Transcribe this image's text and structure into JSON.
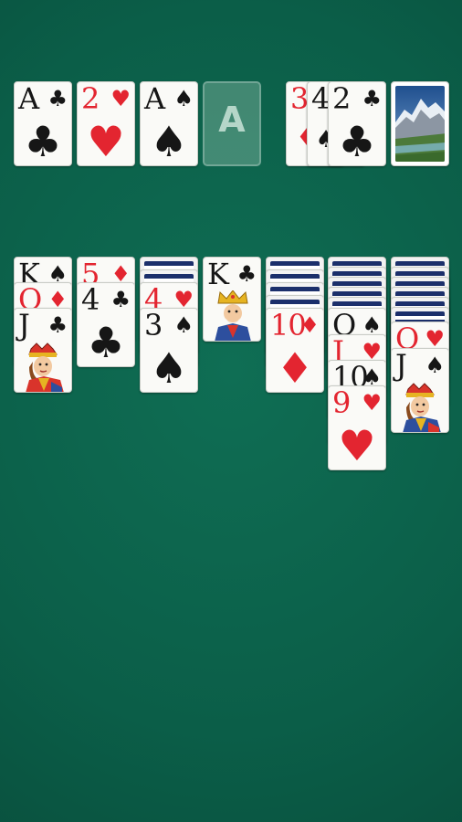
{
  "game": "Solitaire",
  "colors": {
    "felt": "#0b5e48",
    "red_suit": "#e32530",
    "black_suit": "#161616",
    "card_back": "#1b2f6b"
  },
  "foundations": [
    {
      "rank": "A",
      "suit": "♣",
      "color": "black"
    },
    {
      "rank": "2",
      "suit": "♥",
      "color": "red"
    },
    {
      "rank": "A",
      "suit": "♠",
      "color": "black"
    },
    {
      "placeholder": "A"
    }
  ],
  "waste": [
    {
      "rank": "3",
      "suit": "♦",
      "color": "red"
    },
    {
      "rank": "4",
      "suit": "♠",
      "color": "black"
    },
    {
      "rank": "2",
      "suit": "♣",
      "color": "black"
    }
  ],
  "stock": {
    "back_design": "mountain-landscape"
  },
  "tableau": [
    {
      "face_down": 0,
      "cards": [
        {
          "rank": "K",
          "suit": "♠",
          "color": "black"
        },
        {
          "rank": "Q",
          "suit": "♦",
          "color": "red"
        },
        {
          "rank": "J",
          "suit": "♣",
          "color": "black"
        }
      ]
    },
    {
      "face_down": 0,
      "cards": [
        {
          "rank": "5",
          "suit": "♦",
          "color": "red"
        },
        {
          "rank": "4",
          "suit": "♣",
          "color": "black"
        }
      ]
    },
    {
      "face_down": 2,
      "cards": [
        {
          "rank": "4",
          "suit": "♥",
          "color": "red"
        },
        {
          "rank": "3",
          "suit": "♠",
          "color": "black"
        }
      ]
    },
    {
      "face_down": 0,
      "cards": [
        {
          "rank": "K",
          "suit": "♣",
          "color": "black"
        }
      ]
    },
    {
      "face_down": 4,
      "cards": [
        {
          "rank": "10",
          "suit": "♦",
          "color": "red"
        }
      ]
    },
    {
      "face_down": 5,
      "cards": [
        {
          "rank": "Q",
          "suit": "♠",
          "color": "black"
        },
        {
          "rank": "J",
          "suit": "♥",
          "color": "red"
        },
        {
          "rank": "10",
          "suit": "♠",
          "color": "black"
        },
        {
          "rank": "9",
          "suit": "♥",
          "color": "red"
        }
      ]
    },
    {
      "face_down": 6,
      "cards": [
        {
          "rank": "Q",
          "suit": "♥",
          "color": "red"
        },
        {
          "rank": "J",
          "suit": "♠",
          "color": "black"
        }
      ]
    }
  ]
}
